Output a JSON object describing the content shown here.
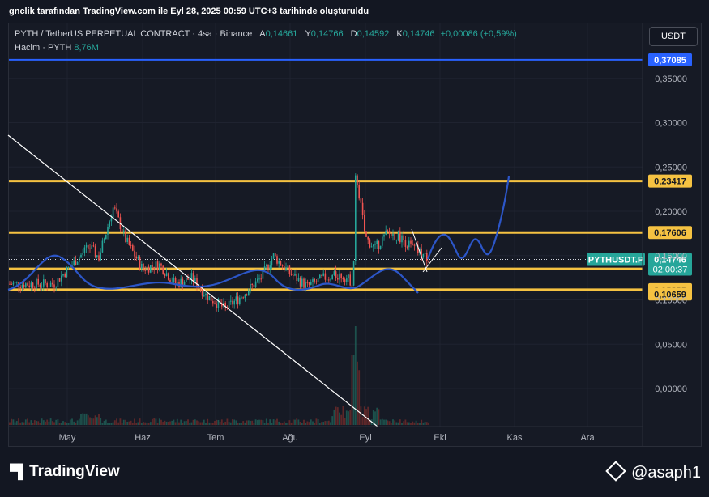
{
  "header": {
    "caption": "gnclik tarafından TradingView.com ile Eyl 28, 2025 00:59 UTC+3 tarihinde oluşturuldu"
  },
  "legend": {
    "symbol": "PYTH / TetherUS PERPETUAL CONTRACT · 4sa · Binance",
    "open_label": "A",
    "open": "0,14661",
    "high_label": "Y",
    "high": "0,14766",
    "low_label": "D",
    "low": "0,14592",
    "close_label": "K",
    "close": "0,14746",
    "change": "+0,00086 (+0,59%)",
    "volume_label": "Hacim · PYTH",
    "volume": "8,76M"
  },
  "currency_button": "USDT",
  "colors": {
    "background": "#161a25",
    "up": "#26a69a",
    "down": "#ef5350",
    "level_line": "#f5c242",
    "projection": "#2c56c8",
    "top_line": "#2962ff",
    "trendline": "#ffffff"
  },
  "chart_data": {
    "type": "candlestick",
    "symbol": "PYTHUSDT.P",
    "ylim": [
      -0.04,
      0.4
    ],
    "y_ticks": [
      "0,35000",
      "0,30000",
      "0,25000",
      "0,20000",
      "0,15000",
      "0,10000",
      "0,05000",
      "0,00000"
    ],
    "x_ticks": [
      "May",
      "Haz",
      "Tem",
      "Ağu",
      "Eyl",
      "Eki",
      "Kas",
      "Ara"
    ],
    "current_price": {
      "label": "PYTHUSDT.P",
      "value": "0,14746",
      "countdown": "02:00:37",
      "price": 0.14746
    },
    "horizontal_levels": [
      {
        "label": "0,37085",
        "price": 0.37085,
        "style": "blue-line"
      },
      {
        "label": "0,23417",
        "price": 0.23417,
        "style": "yellow"
      },
      {
        "label": "0,17606",
        "price": 0.17606,
        "style": "yellow"
      },
      {
        "label": "0,14595",
        "price": 0.135,
        "style": "yellow"
      },
      {
        "label": "0,13093",
        "price": 0.1115,
        "style": "yellow"
      },
      {
        "label": "0,10659",
        "price": 0.10659,
        "style": "yellow-label"
      }
    ],
    "price_path": [
      {
        "t": "Nis 26",
        "p": 0.118
      },
      {
        "t": "May 3",
        "p": 0.14
      },
      {
        "t": "May 10",
        "p": 0.16
      },
      {
        "t": "May 14",
        "p": 0.148
      },
      {
        "t": "May 20",
        "p": 0.205
      },
      {
        "t": "May 25",
        "p": 0.168
      },
      {
        "t": "Haz 1",
        "p": 0.135
      },
      {
        "t": "Haz 8",
        "p": 0.14
      },
      {
        "t": "Haz 15",
        "p": 0.118
      },
      {
        "t": "Haz 22",
        "p": 0.125
      },
      {
        "t": "Haz 28",
        "p": 0.105
      },
      {
        "t": "Tem 5",
        "p": 0.09
      },
      {
        "t": "Tem 12",
        "p": 0.105
      },
      {
        "t": "Tem 20",
        "p": 0.125
      },
      {
        "t": "Tem 25",
        "p": 0.15
      },
      {
        "t": "Ağu 1",
        "p": 0.13
      },
      {
        "t": "Ağu 8",
        "p": 0.115
      },
      {
        "t": "Ağu 15",
        "p": 0.125
      },
      {
        "t": "Ağu 22",
        "p": 0.128
      },
      {
        "t": "Ağu 27",
        "p": 0.12
      },
      {
        "t": "Ağu 28",
        "p": 0.245
      },
      {
        "t": "Eyl 1",
        "p": 0.17
      },
      {
        "t": "Eyl 5",
        "p": 0.158
      },
      {
        "t": "Eyl 10",
        "p": 0.175
      },
      {
        "t": "Eyl 15",
        "p": 0.172
      },
      {
        "t": "Eyl 20",
        "p": 0.16
      },
      {
        "t": "Eyl 27",
        "p": 0.147
      }
    ],
    "volume_spike": {
      "t": "Ağu 28"
    },
    "drawings": [
      "descending trendline",
      "projected wave path",
      "wedge lines"
    ]
  },
  "watermark": {
    "brand": "TradingView",
    "author": "@asaph1"
  }
}
